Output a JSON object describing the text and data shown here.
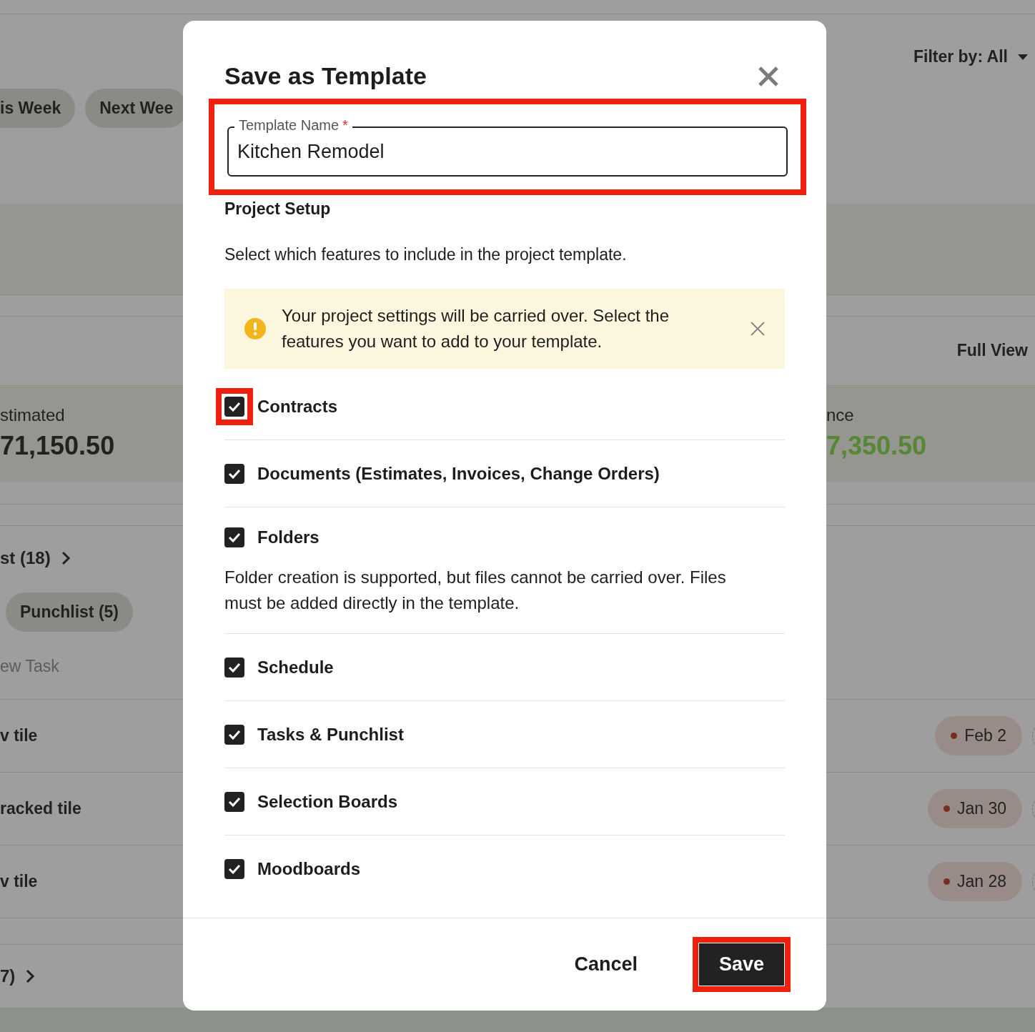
{
  "page": {
    "chips": [
      {
        "label": "is Week"
      },
      {
        "label": "Next Wee"
      }
    ],
    "filter": "Filter by: All",
    "view_link": "Full View",
    "stats": [
      {
        "label": "stimated",
        "value": "71,150.50",
        "positive": false
      },
      {
        "label": "nce",
        "value": "7,350.50",
        "positive": true
      }
    ],
    "sections": [
      {
        "label": "st (18)"
      },
      {
        "label": "7)"
      }
    ],
    "punchlist_chip": "Punchlist (5)",
    "new_task_placeholder": "ew Task",
    "tasks": [
      {
        "title": "v tile",
        "due": "Feb 2"
      },
      {
        "title": "racked tile",
        "due": "Jan 30"
      },
      {
        "title": "v tile",
        "due": "Jan 28"
      }
    ]
  },
  "modal": {
    "title": "Save as Template",
    "field": {
      "label": "Template Name",
      "required": true,
      "required_mark": "*",
      "value": "Kitchen Remodel",
      "highlighted": true
    },
    "section_title": "Project Setup",
    "description": "Select which features to include in the project template.",
    "notice": {
      "text": "Your project settings will be carried over. Select the features you want to add to your template."
    },
    "features": [
      {
        "label": "Contracts",
        "checked": true,
        "highlighted": true
      },
      {
        "label": "Documents (Estimates, Invoices, Change Orders)",
        "checked": true,
        "highlighted": false
      },
      {
        "label": "Folders",
        "checked": true,
        "highlighted": false,
        "note": "Folder creation is supported, but files cannot be carried over. Files must be added directly in the template."
      },
      {
        "label": "Schedule",
        "checked": true,
        "highlighted": false
      },
      {
        "label": "Tasks & Punchlist",
        "checked": true,
        "highlighted": false
      },
      {
        "label": "Selection Boards",
        "checked": true,
        "highlighted": false
      },
      {
        "label": "Moodboards",
        "checked": true,
        "highlighted": false
      }
    ],
    "buttons": [
      {
        "kind": "secondary",
        "label": "Cancel",
        "highlighted": false
      },
      {
        "kind": "primary",
        "label": "Save",
        "highlighted": true
      }
    ]
  }
}
